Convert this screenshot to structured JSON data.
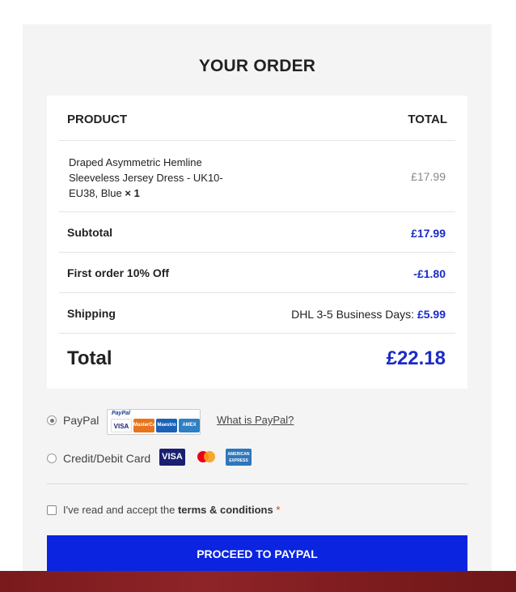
{
  "order": {
    "title": "YOUR ORDER",
    "header": {
      "product": "PRODUCT",
      "total": "TOTAL"
    },
    "item": {
      "name": "Draped Asymmetric Hemline Sleeveless Jersey Dress - UK10-EU38, Blue",
      "qty": "× 1",
      "price": "£17.99"
    },
    "subtotal": {
      "label": "Subtotal",
      "value": "£17.99"
    },
    "discount": {
      "label": "First order 10% Off",
      "value": "-£1.80"
    },
    "shipping": {
      "label": "Shipping",
      "method": "DHL 3-5 Business Days:",
      "value": "£5.99"
    },
    "total": {
      "label": "Total",
      "value": "£22.18"
    }
  },
  "payment": {
    "paypal": {
      "label": "PayPal",
      "badge": "PayPal",
      "cards": [
        "VISA",
        "MasterCard",
        "Maestro",
        "AMEX"
      ],
      "link": "What is PayPal?",
      "selected": true
    },
    "card": {
      "label": "Credit/Debit Card",
      "logos": [
        "VISA",
        "MasterCard",
        "AMERICAN EXPRESS"
      ],
      "selected": false
    }
  },
  "terms": {
    "prefix": "I've read and accept the ",
    "link": "terms & conditions",
    "required": "*"
  },
  "cta": {
    "label": "PROCEED TO PAYPAL"
  },
  "colors": {
    "accent": "#0a24e0",
    "price_blue": "#1a2bc7",
    "panel": "#f4f4f4",
    "footer": "#8e2428"
  }
}
